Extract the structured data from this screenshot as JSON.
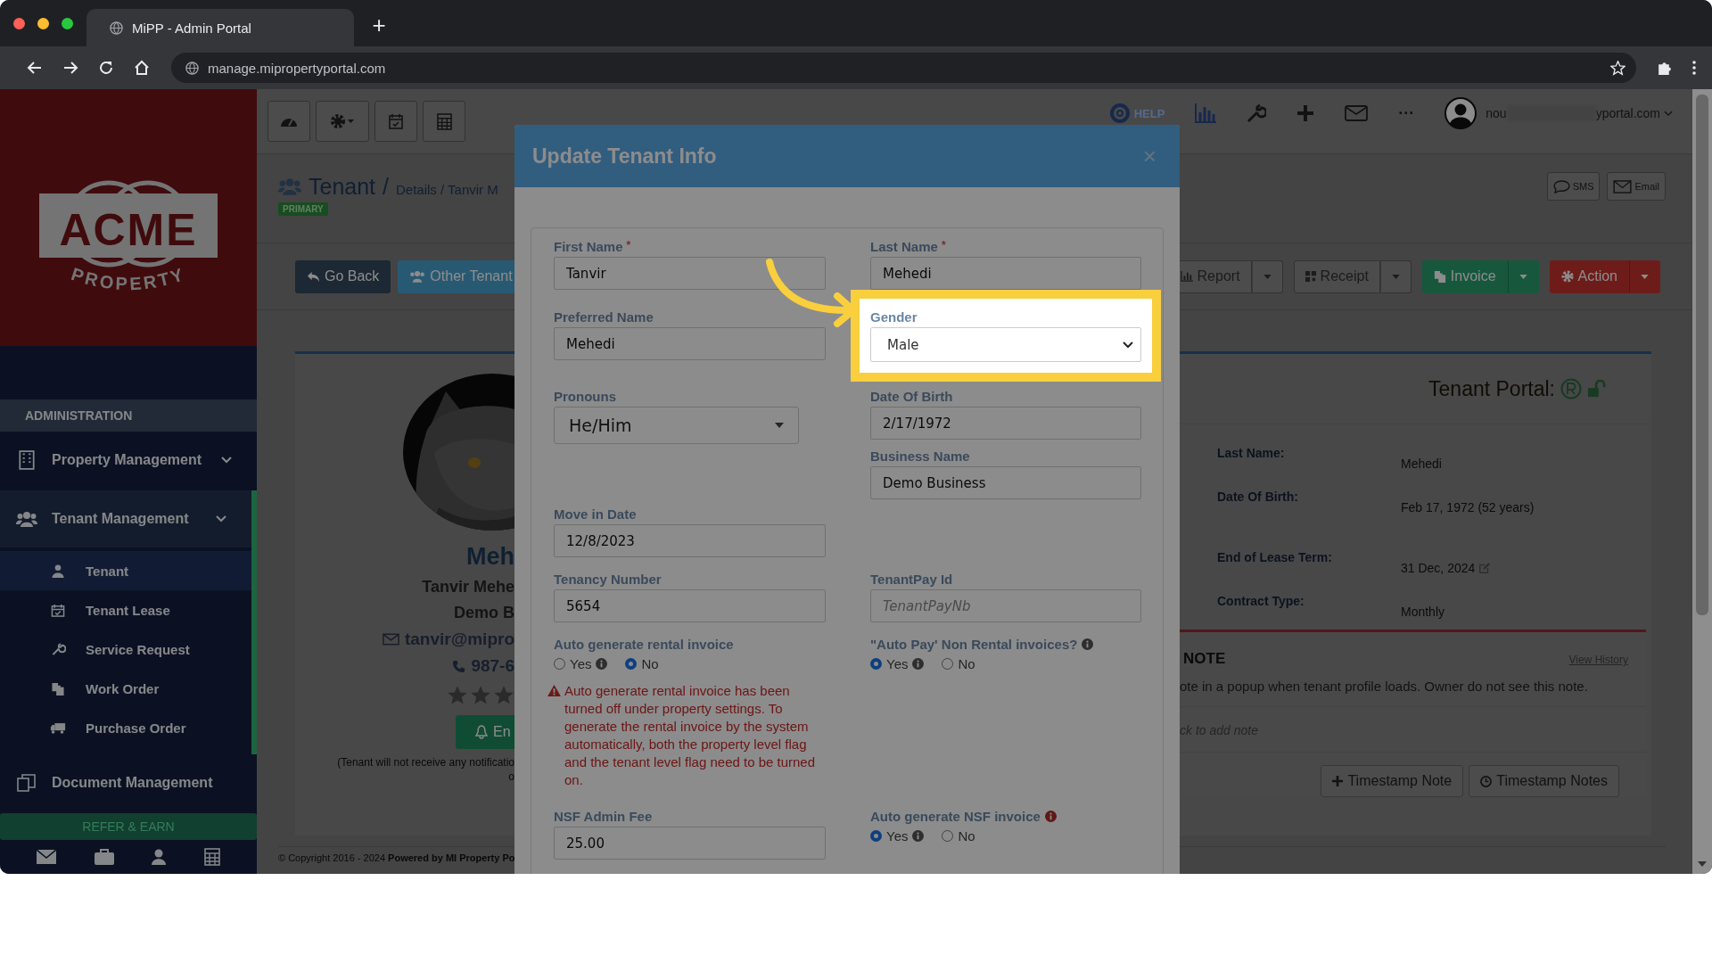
{
  "browser": {
    "tab_title": "MiPP - Admin Portal",
    "new_tab": "+",
    "url": "manage.mipropertyportal.com"
  },
  "toolbar": {
    "help": "HELP",
    "more": "···",
    "user_email_start": "nou",
    "user_email_end": "yportal.com"
  },
  "sidebar": {
    "logo_word": "ACME",
    "logo_subtitle": "PROPERTY",
    "section": "ADMINISTRATION",
    "items": [
      {
        "label": "Property Management",
        "expanded": false
      },
      {
        "label": "Tenant Management",
        "expanded": true,
        "children": [
          {
            "label": "Tenant",
            "selected": true
          },
          {
            "label": "Tenant Lease",
            "selected": false
          },
          {
            "label": "Service Request",
            "selected": false
          },
          {
            "label": "Work Order",
            "selected": false
          },
          {
            "label": "Purchase Order",
            "selected": false
          }
        ]
      },
      {
        "label": "Document Management"
      }
    ],
    "refer": "REFER & EARN"
  },
  "page": {
    "title": "Tenant",
    "separator": "/",
    "breadcrumb": "Details / Tanvir M",
    "badge": "PRIMARY",
    "sms": "SMS",
    "email": "Email",
    "left_buttons": [
      {
        "label": "Go Back",
        "kind": "dark"
      },
      {
        "label": "Other Tenant",
        "kind": "info"
      }
    ],
    "right_buttons": [
      {
        "label": "Report",
        "kind": "default"
      },
      {
        "label": "Receipt",
        "kind": "default"
      },
      {
        "label": "Invoice",
        "kind": "success"
      },
      {
        "label": "Action",
        "kind": "danger"
      }
    ],
    "profile": {
      "name": "Meh",
      "full_name": "Tanvir Mehe",
      "business": "Demo B",
      "email": "tanvir@mipro",
      "phone": "987-6",
      "stars": 0,
      "notify_button": "En",
      "notice_line1": "(Tenant will not receive any notificatio",
      "notice_line2": "o"
    },
    "portal": {
      "title": "Tenant Portal:",
      "details": [
        {
          "label": "Last Name:",
          "value": "Mehedi"
        },
        {
          "label": "Date Of Birth:",
          "value": "Feb 17, 1972 (52 years)"
        },
        {
          "label": "End of Lease Term:",
          "value": "31 Dec, 2024",
          "editable": true
        },
        {
          "label": "Contract Type:",
          "value": "Monthly"
        }
      ]
    },
    "note": {
      "title": "NOTE",
      "history": "View History",
      "text": "ote in a popup when tenant profile loads. Owner do not see this note.",
      "placeholder": "ck to add note",
      "buttons": [
        "Timestamp Note",
        "Timestamp Notes"
      ]
    },
    "footer": "© Copyright 2016 - 2024 **Powered by MI Property Po**"
  },
  "modal": {
    "title": "Update Tenant Info",
    "close": "×",
    "rows": [
      {
        "left": [
          {
            "kind": "input",
            "label": "First Name",
            "required_mark": "*",
            "value": "Tanvir"
          }
        ],
        "right": [
          {
            "kind": "input",
            "label": "Last Name",
            "required_mark": "*",
            "value": "Mehedi"
          }
        ]
      },
      {
        "left": [
          {
            "kind": "input",
            "label": "Preferred Name",
            "value": "Mehedi"
          }
        ],
        "right": [
          {
            "kind": "select",
            "label": "Gender",
            "value": "Male",
            "highlighted": true
          }
        ]
      },
      {
        "left": [
          {
            "kind": "dropdown",
            "label": "Pronouns",
            "value": "He/Him"
          }
        ],
        "right": [
          {
            "kind": "input",
            "label": "Date Of Birth",
            "value": "2/17/1972"
          },
          {
            "kind": "input",
            "label": "Business Name",
            "value": "Demo Business"
          }
        ]
      },
      {
        "left": [
          {
            "kind": "input",
            "label": "Move in Date",
            "value": "12/8/2023"
          }
        ]
      },
      {
        "left": [
          {
            "kind": "input",
            "label": "Tenancy Number",
            "value": "5654"
          }
        ],
        "right": [
          {
            "kind": "input",
            "label": "TenantPay Id",
            "placeholder": "TenantPayNb"
          }
        ]
      },
      {
        "left": [
          {
            "kind": "radio",
            "label": "Auto generate rental invoice",
            "options": [
              {
                "label": "Yes",
                "info": true,
                "selected": false
              },
              {
                "label": "No",
                "selected": true
              }
            ],
            "warning": "Auto generate rental invoice has been turned off under property settings. To generate the rental invoice by the system automatically, both the property level flag and the tenant level flag need to be turned on."
          }
        ],
        "right": [
          {
            "kind": "radio",
            "label": "\"Auto Pay' Non Rental invoices?",
            "info": true,
            "options": [
              {
                "label": "Yes",
                "info": true,
                "selected": true
              },
              {
                "label": "No",
                "selected": false
              }
            ]
          }
        ]
      },
      {
        "left": [
          {
            "kind": "input",
            "label": "NSF Admin Fee",
            "value": "25.00"
          }
        ],
        "right": [
          {
            "kind": "radio",
            "label": "Auto generate NSF invoice",
            "info": true,
            "info_alert": true,
            "options": [
              {
                "label": "Yes",
                "info": true,
                "selected": true
              },
              {
                "label": "No",
                "selected": false
              }
            ]
          }
        ]
      }
    ]
  }
}
